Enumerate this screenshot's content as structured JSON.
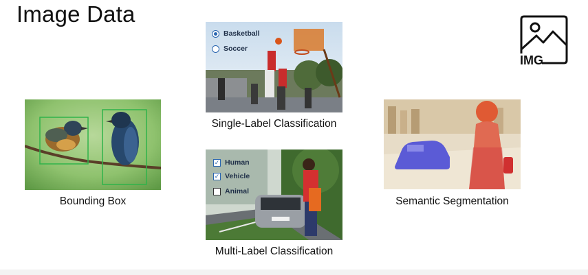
{
  "slide": {
    "title": "Image Data",
    "icon": {
      "name": "img-icon",
      "label": "IMG"
    }
  },
  "panels": {
    "bounding_box": {
      "caption": "Bounding Box"
    },
    "single_label": {
      "caption": "Single-Label Classification",
      "options": [
        {
          "label": "Basketball",
          "selected": true
        },
        {
          "label": "Soccer",
          "selected": false
        }
      ]
    },
    "multi_label": {
      "caption": "Multi-Label Classification",
      "options": [
        {
          "label": "Human",
          "checked": true
        },
        {
          "label": "Vehicle",
          "checked": true
        },
        {
          "label": "Animal",
          "checked": false
        }
      ]
    },
    "segmentation": {
      "caption": "Semantic Segmentation"
    }
  },
  "colors": {
    "accent": "#2b66b0",
    "box_green": "#2fb34a",
    "car_mask": "#5b5bd6",
    "person_mask": "#e05a33"
  }
}
